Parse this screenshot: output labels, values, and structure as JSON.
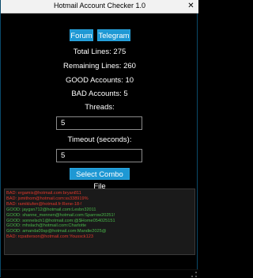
{
  "window": {
    "title": "Hotmail Account Checker 1.0",
    "close_glyph": "✕"
  },
  "buttons": {
    "forum": "Forum",
    "telegram": "Telegram",
    "select_combo": "Select Combo File"
  },
  "stats": {
    "total_lines": "Total Lines: 275",
    "remaining_lines": "Remaining Lines: 260",
    "good_accounts": "GOOD Accounts: 10",
    "bad_accounts": "BAD Accounts: 5"
  },
  "threads": {
    "label": "Threads:",
    "value": "5"
  },
  "timeout": {
    "label": "Timeout (seconds):",
    "value": "5"
  },
  "log": [
    {
      "status": "bad",
      "text": "BAD: ergamis@hotmail.com:bryan811"
    },
    {
      "status": "bad",
      "text": "BAD: jsmithom@hotmail.com:ss338919%"
    },
    {
      "status": "bad",
      "text": "BAD: ramiklufen@hotmail.fr:Rene-18-!"
    },
    {
      "status": "good",
      "text": "GOOD: jaygsn712@hotmail.com:Lesbn32011"
    },
    {
      "status": "good",
      "text": "GOOD: shanne_mennen@hotmail.com:Sparrow20251!"
    },
    {
      "status": "good",
      "text": "GOOD: sonnelsch1@hotmail.com:@$Home054025151"
    },
    {
      "status": "good",
      "text": "GOOD: mhslach@hotmail.com:Charlotte"
    },
    {
      "status": "good",
      "text": "GOOD: amanda09sp@hotmail.com:Mandie2025@"
    },
    {
      "status": "bad",
      "text": "BAD: rcpatterson@hotmail.com:Youssck123"
    }
  ],
  "colors": {
    "accent": "#1e98d4",
    "bad": "#e0382c",
    "good": "#49b749",
    "background": "#000000"
  }
}
